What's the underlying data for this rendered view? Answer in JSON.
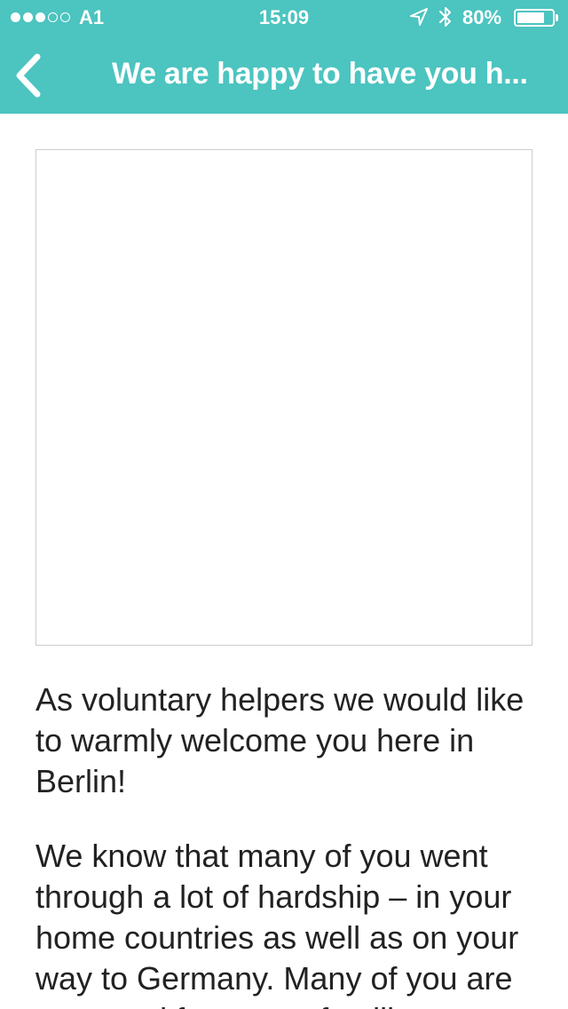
{
  "status_bar": {
    "signal_strength": "3 of 5",
    "carrier": "A1",
    "time": "15:09",
    "location_icon": "location-arrow-icon",
    "bluetooth_icon": "bluetooth-icon",
    "battery_percent": "80%",
    "battery_level": 0.8
  },
  "nav": {
    "back_icon": "chevron-left-icon",
    "title": "We are happy to have you h..."
  },
  "article": {
    "paragraphs": [
      "As voluntary helpers we would like to warmly welcome you here in Berlin!",
      "We know that many of you went through a lot of hardship – in your home countries as well as on your way to Germany. Many of you are sepaated from your families"
    ]
  },
  "colors": {
    "accent": "#4cc4c0",
    "text": "#222222",
    "background": "#ffffff"
  }
}
